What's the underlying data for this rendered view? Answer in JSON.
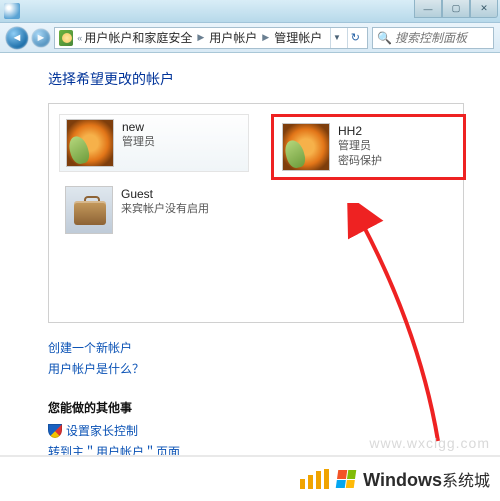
{
  "breadcrumb": {
    "items": [
      "用户帐户和家庭安全",
      "用户帐户",
      "管理帐户"
    ]
  },
  "search": {
    "placeholder": "搜索控制面板"
  },
  "page": {
    "title": "选择希望更改的帐户"
  },
  "accounts": [
    {
      "name": "new",
      "role": "管理员"
    },
    {
      "name": "Guest",
      "role": "来宾帐户没有启用"
    },
    {
      "name": "HH2",
      "role": "管理员",
      "extra": "密码保护"
    }
  ],
  "links": {
    "create": "创建一个新帐户",
    "whatis": "用户帐户是什么？"
  },
  "section2": {
    "title": "您能做的其他事",
    "parental": "设置家长控制",
    "goto": "转到主＂用户帐户＂页面"
  },
  "watermark": "www.wxclgg.com",
  "footer": {
    "brand_bold": "Windows",
    "brand_rest": "系统城"
  }
}
